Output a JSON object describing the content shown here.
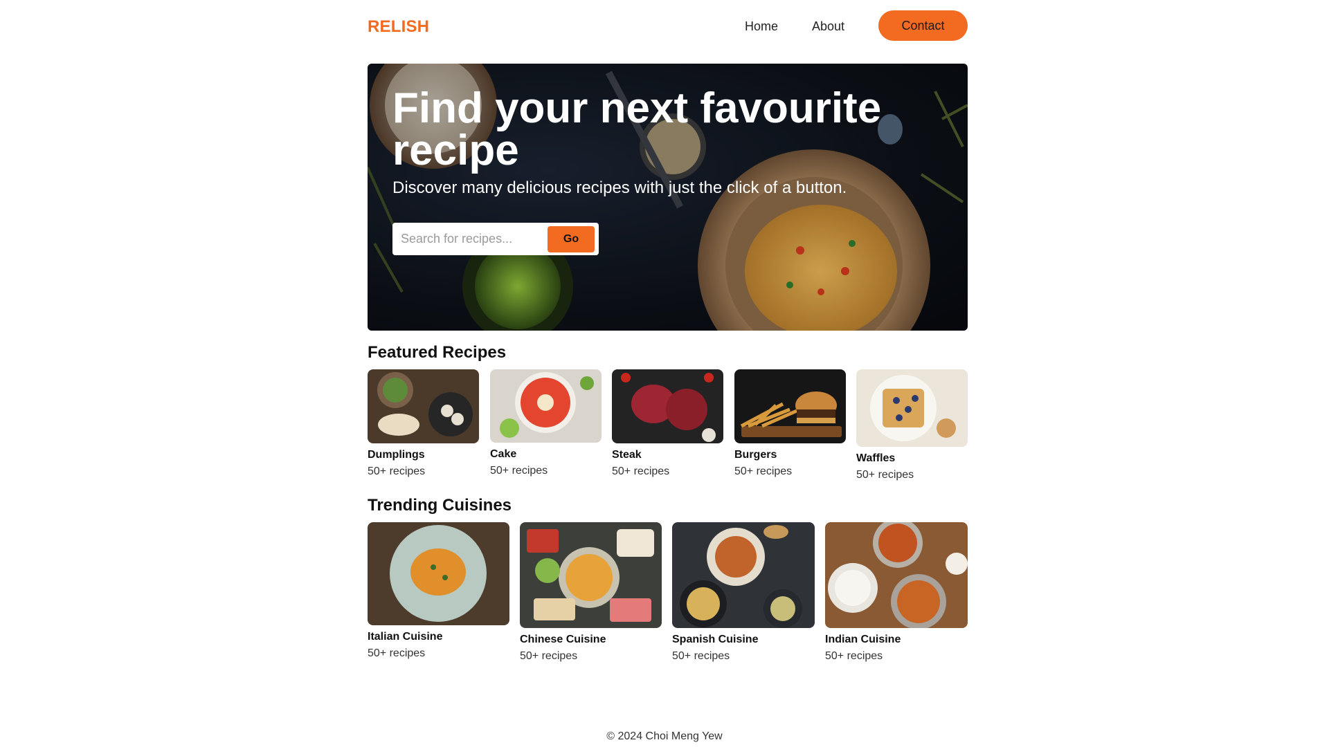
{
  "brand": {
    "logo": "RELISH",
    "accent": "#f26b21"
  },
  "nav": {
    "home": "Home",
    "about": "About",
    "contact": "Contact"
  },
  "hero": {
    "title": "Find your next favourite recipe",
    "subtitle": "Discover many delicious recipes with just the click of a button.",
    "search_placeholder": "Search for recipes...",
    "search_value": "",
    "go": "Go"
  },
  "featured": {
    "title": "Featured Recipes",
    "items": [
      {
        "name": "Dumplings",
        "count": "50+ recipes",
        "icon": "dumplings-photo"
      },
      {
        "name": "Cake",
        "count": "50+ recipes",
        "icon": "cake-photo"
      },
      {
        "name": "Steak",
        "count": "50+ recipes",
        "icon": "steak-photo"
      },
      {
        "name": "Burgers",
        "count": "50+ recipes",
        "icon": "burgers-photo"
      },
      {
        "name": "Waffles",
        "count": "50+ recipes",
        "icon": "waffles-photo"
      }
    ]
  },
  "trending": {
    "title": "Trending Cuisines",
    "items": [
      {
        "name": "Italian Cuisine",
        "count": "50+ recipes",
        "icon": "italian-photo"
      },
      {
        "name": "Chinese Cuisine",
        "count": "50+ recipes",
        "icon": "chinese-photo"
      },
      {
        "name": "Spanish Cuisine",
        "count": "50+ recipes",
        "icon": "spanish-photo"
      },
      {
        "name": "Indian Cuisine",
        "count": "50+ recipes",
        "icon": "indian-photo"
      }
    ]
  },
  "footer": {
    "text": "© 2024 Choi Meng Yew"
  }
}
